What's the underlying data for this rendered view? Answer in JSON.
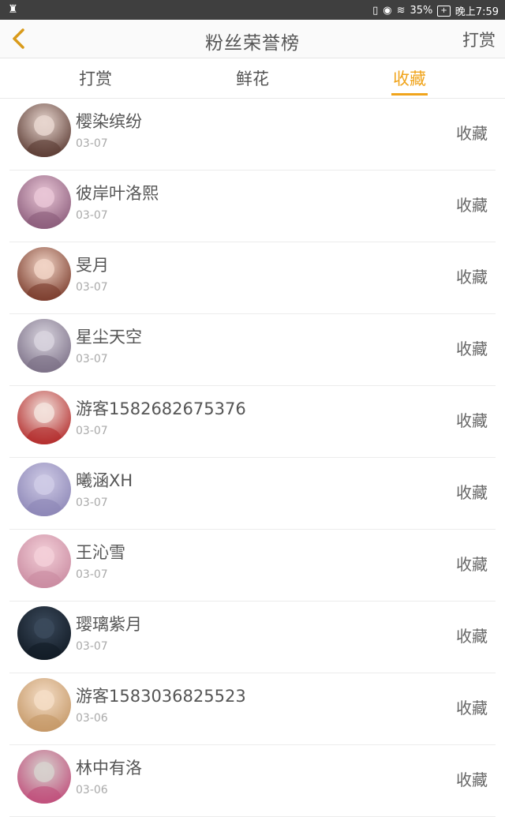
{
  "status_bar": {
    "battery": "35%",
    "time": "晚上7:59"
  },
  "header": {
    "title": "粉丝荣誉榜",
    "action": "打赏",
    "back_icon": "chevron-left-icon",
    "accent_color": "#f0a41c"
  },
  "tabs": [
    {
      "label": "打赏",
      "active": false
    },
    {
      "label": "鲜花",
      "active": false
    },
    {
      "label": "收藏",
      "active": true
    }
  ],
  "list": [
    {
      "name": "樱染缤纷",
      "date": "03-07",
      "action": "收藏",
      "avatar_colors": [
        "#e8d6cf",
        "#5a3a32"
      ]
    },
    {
      "name": "彼岸叶洛熙",
      "date": "03-07",
      "action": "收藏",
      "avatar_colors": [
        "#e9c6d6",
        "#8a5b7a"
      ]
    },
    {
      "name": "旻月",
      "date": "03-07",
      "action": "收藏",
      "avatar_colors": [
        "#f1d4c6",
        "#7a3b2b"
      ]
    },
    {
      "name": "星尘天空",
      "date": "03-07",
      "action": "收藏",
      "avatar_colors": [
        "#d8d4de",
        "#7b6f86"
      ]
    },
    {
      "name": "游客1582682675376",
      "date": "03-07",
      "action": "收藏",
      "avatar_colors": [
        "#f3e2dc",
        "#b22a2a"
      ]
    },
    {
      "name": "曦涵XH",
      "date": "03-07",
      "action": "收藏",
      "avatar_colors": [
        "#cfcbe6",
        "#8c86b6"
      ]
    },
    {
      "name": "王沁雪",
      "date": "03-07",
      "action": "收藏",
      "avatar_colors": [
        "#f3cfd8",
        "#c98aa0"
      ]
    },
    {
      "name": "璎璃紫月",
      "date": "03-07",
      "action": "收藏",
      "avatar_colors": [
        "#3b4a5c",
        "#111a24"
      ]
    },
    {
      "name": "游客1583036825523",
      "date": "03-06",
      "action": "收藏",
      "avatar_colors": [
        "#f4ddc6",
        "#c49766"
      ]
    },
    {
      "name": "林中有洛",
      "date": "03-06",
      "action": "收藏",
      "avatar_colors": [
        "#d7d1ce",
        "#c04d7a"
      ]
    }
  ]
}
